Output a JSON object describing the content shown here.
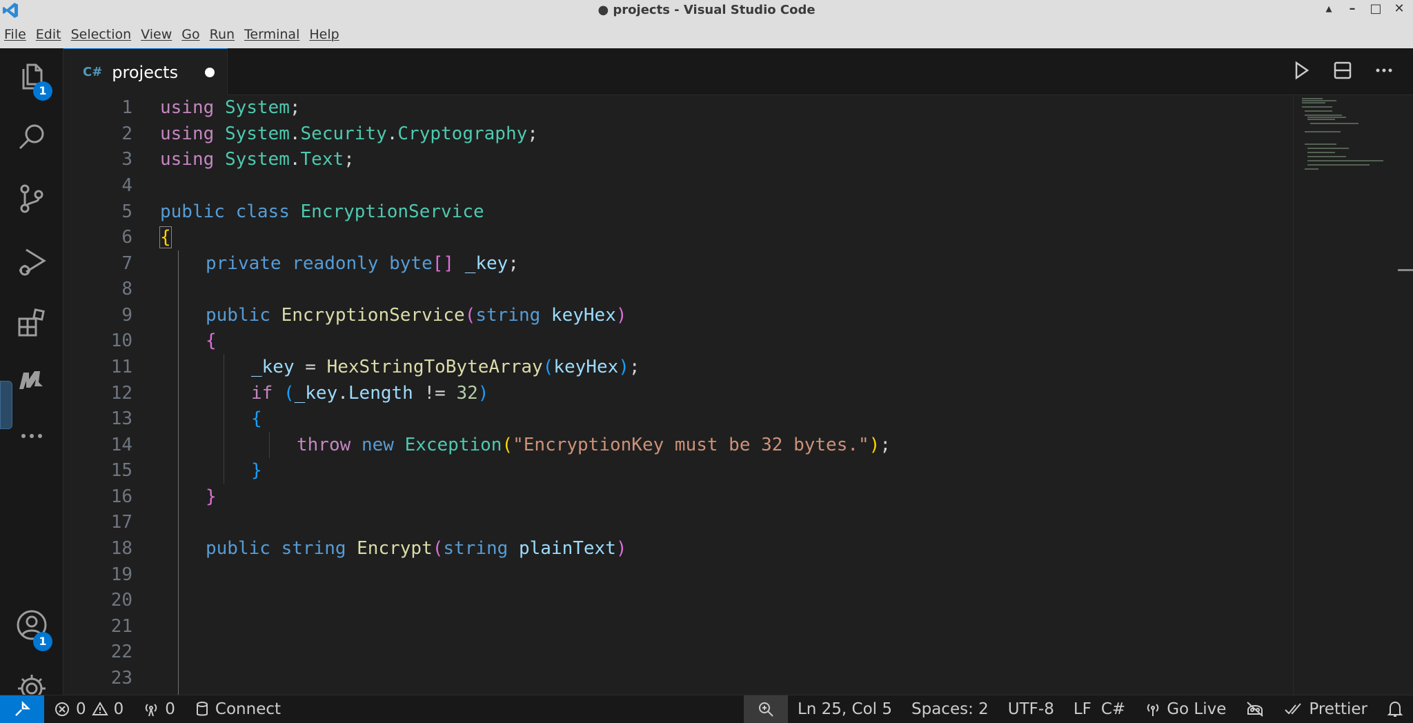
{
  "window": {
    "title": "● projects - Visual Studio Code",
    "controls": [
      "▴",
      "–",
      "□",
      "✕"
    ]
  },
  "menu": [
    "File",
    "Edit",
    "Selection",
    "View",
    "Go",
    "Run",
    "Terminal",
    "Help"
  ],
  "activity_bar": {
    "explorer_badge": "1",
    "accounts_badge": "1"
  },
  "tab": {
    "label": "projects",
    "icon": "C#",
    "modified": true
  },
  "editor": {
    "line_numbers": [
      "1",
      "2",
      "3",
      "4",
      "5",
      "6",
      "7",
      "8",
      "9",
      "10",
      "11",
      "12",
      "13",
      "14",
      "15",
      "16",
      "17",
      "18",
      "19",
      "20",
      "21",
      "22",
      "23"
    ],
    "code": {
      "l1": [
        "using",
        "System",
        ";"
      ],
      "l2": [
        "using",
        "System",
        ".",
        "Security",
        ".",
        "Cryptography",
        ";"
      ],
      "l3": [
        "using",
        "System",
        ".",
        "Text",
        ";"
      ],
      "l5": [
        "public",
        "class",
        "EncryptionService"
      ],
      "l6": [
        "{"
      ],
      "l7": [
        "private",
        "readonly",
        "byte",
        "[]",
        "_key",
        ";"
      ],
      "l9": [
        "public",
        "EncryptionService",
        "(",
        "string",
        "keyHex",
        ")"
      ],
      "l10": [
        "{"
      ],
      "l11": [
        "_key",
        " = ",
        "HexStringToByteArray",
        "(",
        "keyHex",
        ")",
        ";"
      ],
      "l12": [
        "if",
        "(",
        "_key",
        ".",
        "Length",
        " != ",
        "32",
        ")"
      ],
      "l13": [
        "{"
      ],
      "l14": [
        "throw",
        "new",
        "Exception",
        "(",
        "\"EncryptionKey must be 32 bytes.\"",
        ")",
        ";"
      ],
      "l15": [
        "}"
      ],
      "l16": [
        "}"
      ],
      "l18": [
        "public",
        "string",
        "Encrypt",
        "(",
        "string",
        "plainText",
        ")"
      ]
    }
  },
  "status": {
    "errors": "0",
    "warnings": "0",
    "ports": "0",
    "connect": "Connect",
    "position": "Ln 25, Col 5",
    "spaces": "Spaces: 2",
    "encoding": "UTF-8",
    "eol": "LF",
    "language": "C#",
    "go_live": "Go Live",
    "prettier": "Prettier"
  },
  "colors": {
    "accent": "#0078d4",
    "keyword": "#569cd6",
    "control_keyword": "#c586c0",
    "type": "#4ec9b0",
    "function": "#dcdcaa",
    "variable": "#9cdcfe",
    "string": "#ce9178",
    "number": "#b5cea8"
  }
}
